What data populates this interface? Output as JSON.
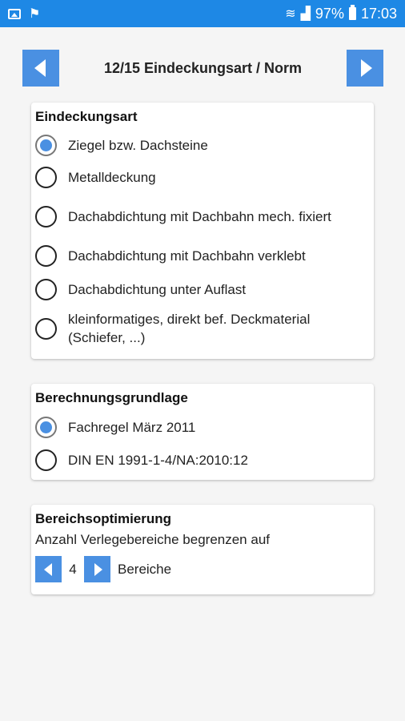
{
  "status_bar": {
    "battery": "97%",
    "time": "17:03",
    "icons": [
      "image-icon",
      "flag-icon",
      "wifi-icon",
      "signal-icon",
      "battery-icon"
    ]
  },
  "header": {
    "title": "12/15 Eindeckungsart / Norm",
    "prev_icon": "arrow-left-icon",
    "next_icon": "arrow-right-icon",
    "accent_color": "#4a90e2"
  },
  "eindeckungsart": {
    "title": "Eindeckungsart",
    "options": [
      {
        "label": "Ziegel bzw. Dachsteine",
        "selected": true
      },
      {
        "label": "Metalldeckung",
        "selected": false
      },
      {
        "label": "Dachabdichtung mit Dachbahn mech. fixiert",
        "selected": false
      },
      {
        "label": "Dachabdichtung mit Dachbahn verklebt",
        "selected": false
      },
      {
        "label": "Dachabdichtung unter Auflast",
        "selected": false
      },
      {
        "label": "kleinformatiges, direkt bef. Deckmaterial (Schiefer, ...)",
        "selected": false
      }
    ]
  },
  "berechnungsgrundlage": {
    "title": "Berechnungsgrundlage",
    "options": [
      {
        "label": "Fachregel März 2011",
        "selected": true
      },
      {
        "label": "DIN EN 1991-1-4/NA:2010:12",
        "selected": false
      }
    ]
  },
  "bereichsoptimierung": {
    "title": "Bereichsoptimierung",
    "description": "Anzahl Verlegebereiche begrenzen auf",
    "value": "4",
    "unit": "Bereiche"
  }
}
